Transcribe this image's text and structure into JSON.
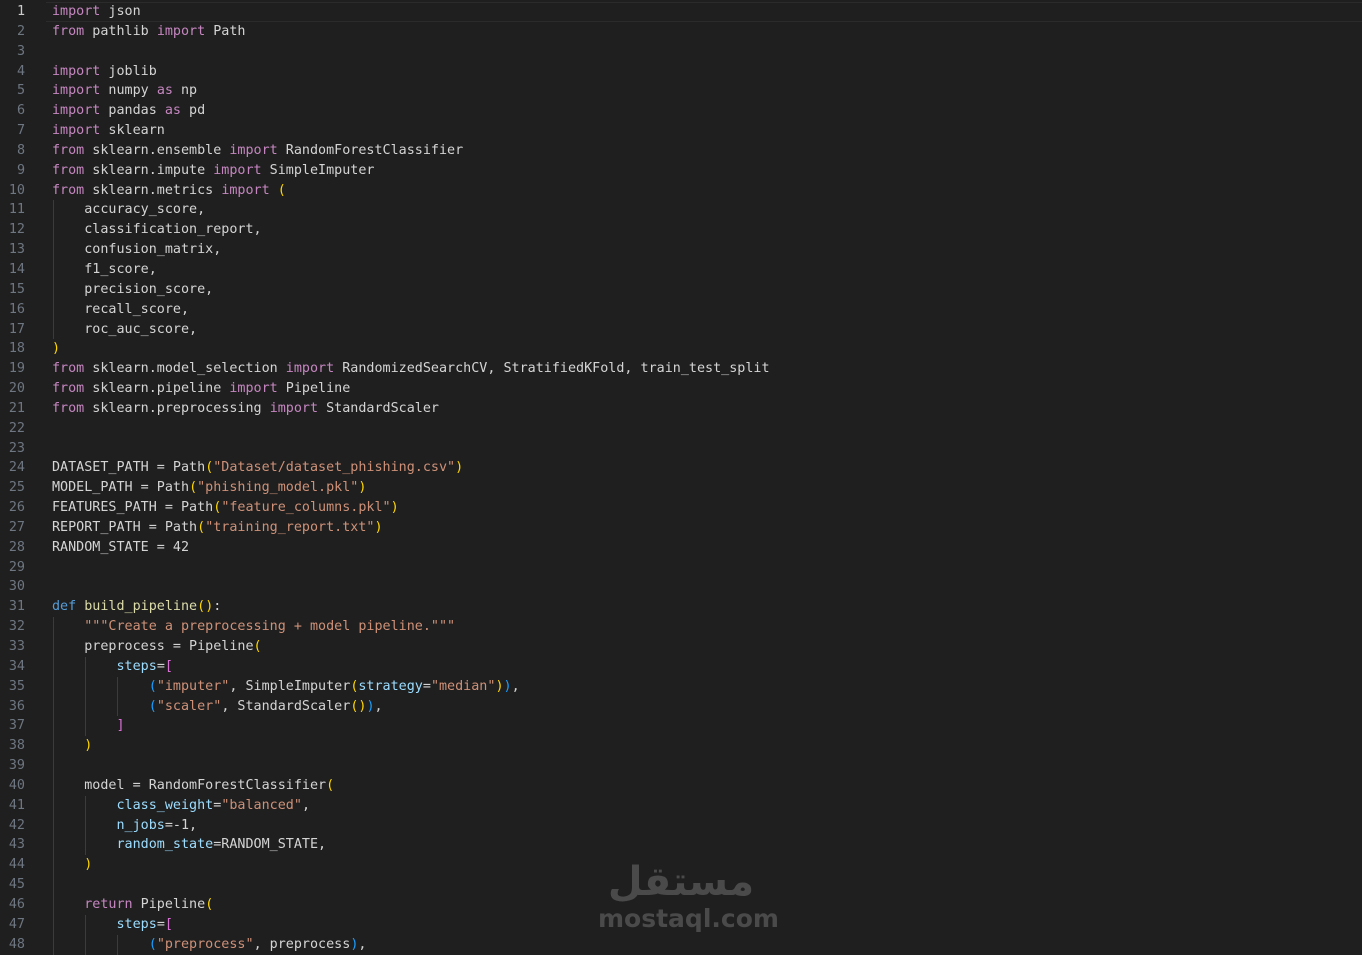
{
  "editor": {
    "current_line": 1,
    "theme_colors": {
      "background": "#1f1f1f",
      "keyword_control": "#c586c0",
      "keyword": "#569cd6",
      "function": "#dcdcaa",
      "string": "#ce9178",
      "number": "#b5cea8",
      "parameter": "#9cdcfe",
      "bracket_1": "#ffd700",
      "bracket_2": "#da70d6",
      "bracket_3": "#179fff",
      "default": "#d4d4d4"
    },
    "lines": [
      {
        "n": "1",
        "t": [
          [
            "ctrl",
            "import"
          ],
          [
            "def",
            " json"
          ]
        ]
      },
      {
        "n": "2",
        "t": [
          [
            "ctrl",
            "from"
          ],
          [
            "def",
            " pathlib "
          ],
          [
            "ctrl",
            "import"
          ],
          [
            "def",
            " Path"
          ]
        ]
      },
      {
        "n": "3",
        "t": []
      },
      {
        "n": "4",
        "t": [
          [
            "ctrl",
            "import"
          ],
          [
            "def",
            " joblib"
          ]
        ]
      },
      {
        "n": "5",
        "t": [
          [
            "ctrl",
            "import"
          ],
          [
            "def",
            " numpy "
          ],
          [
            "ctrl",
            "as"
          ],
          [
            "def",
            " np"
          ]
        ]
      },
      {
        "n": "6",
        "t": [
          [
            "ctrl",
            "import"
          ],
          [
            "def",
            " pandas "
          ],
          [
            "ctrl",
            "as"
          ],
          [
            "def",
            " pd"
          ]
        ]
      },
      {
        "n": "7",
        "t": [
          [
            "ctrl",
            "import"
          ],
          [
            "def",
            " sklearn"
          ]
        ]
      },
      {
        "n": "8",
        "t": [
          [
            "ctrl",
            "from"
          ],
          [
            "def",
            " sklearn.ensemble "
          ],
          [
            "ctrl",
            "import"
          ],
          [
            "def",
            " RandomForestClassifier"
          ]
        ]
      },
      {
        "n": "9",
        "t": [
          [
            "ctrl",
            "from"
          ],
          [
            "def",
            " sklearn.impute "
          ],
          [
            "ctrl",
            "import"
          ],
          [
            "def",
            " SimpleImputer"
          ]
        ]
      },
      {
        "n": "10",
        "t": [
          [
            "ctrl",
            "from"
          ],
          [
            "def",
            " sklearn.metrics "
          ],
          [
            "ctrl",
            "import"
          ],
          [
            "def",
            " "
          ],
          [
            "p1",
            "("
          ]
        ]
      },
      {
        "n": "11",
        "i": 1,
        "t": [
          [
            "def",
            "    accuracy_score,"
          ]
        ]
      },
      {
        "n": "12",
        "i": 1,
        "t": [
          [
            "def",
            "    classification_report,"
          ]
        ]
      },
      {
        "n": "13",
        "i": 1,
        "t": [
          [
            "def",
            "    confusion_matrix,"
          ]
        ]
      },
      {
        "n": "14",
        "i": 1,
        "t": [
          [
            "def",
            "    f1_score,"
          ]
        ]
      },
      {
        "n": "15",
        "i": 1,
        "t": [
          [
            "def",
            "    precision_score,"
          ]
        ]
      },
      {
        "n": "16",
        "i": 1,
        "t": [
          [
            "def",
            "    recall_score,"
          ]
        ]
      },
      {
        "n": "17",
        "i": 1,
        "t": [
          [
            "def",
            "    roc_auc_score,"
          ]
        ]
      },
      {
        "n": "18",
        "t": [
          [
            "p1",
            ")"
          ]
        ]
      },
      {
        "n": "19",
        "t": [
          [
            "ctrl",
            "from"
          ],
          [
            "def",
            " sklearn.model_selection "
          ],
          [
            "ctrl",
            "import"
          ],
          [
            "def",
            " RandomizedSearchCV, StratifiedKFold, train_test_split"
          ]
        ]
      },
      {
        "n": "20",
        "t": [
          [
            "ctrl",
            "from"
          ],
          [
            "def",
            " sklearn.pipeline "
          ],
          [
            "ctrl",
            "import"
          ],
          [
            "def",
            " Pipeline"
          ]
        ]
      },
      {
        "n": "21",
        "t": [
          [
            "ctrl",
            "from"
          ],
          [
            "def",
            " sklearn.preprocessing "
          ],
          [
            "ctrl",
            "import"
          ],
          [
            "def",
            " StandardScaler"
          ]
        ]
      },
      {
        "n": "22",
        "t": []
      },
      {
        "n": "23",
        "t": []
      },
      {
        "n": "24",
        "t": [
          [
            "def",
            "DATASET_PATH = Path"
          ],
          [
            "p1",
            "("
          ],
          [
            "str",
            "\"Dataset/dataset_phishing.csv\""
          ],
          [
            "p1",
            ")"
          ]
        ]
      },
      {
        "n": "25",
        "t": [
          [
            "def",
            "MODEL_PATH = Path"
          ],
          [
            "p1",
            "("
          ],
          [
            "str",
            "\"phishing_model.pkl\""
          ],
          [
            "p1",
            ")"
          ]
        ]
      },
      {
        "n": "26",
        "t": [
          [
            "def",
            "FEATURES_PATH = Path"
          ],
          [
            "p1",
            "("
          ],
          [
            "str",
            "\"feature_columns.pkl\""
          ],
          [
            "p1",
            ")"
          ]
        ]
      },
      {
        "n": "27",
        "t": [
          [
            "def",
            "REPORT_PATH = Path"
          ],
          [
            "p1",
            "("
          ],
          [
            "str",
            "\"training_report.txt\""
          ],
          [
            "p1",
            ")"
          ]
        ]
      },
      {
        "n": "28",
        "t": [
          [
            "def",
            "RANDOM_STATE = 42"
          ]
        ]
      },
      {
        "n": "29",
        "t": []
      },
      {
        "n": "30",
        "t": []
      },
      {
        "n": "31",
        "t": [
          [
            "kw",
            "def"
          ],
          [
            "def",
            " "
          ],
          [
            "fn",
            "build_pipeline"
          ],
          [
            "p1",
            "("
          ],
          [
            "p1",
            ")"
          ],
          [
            "def",
            ":"
          ]
        ]
      },
      {
        "n": "32",
        "i": 1,
        "t": [
          [
            "def",
            "    "
          ],
          [
            "str",
            "\"\"\"Create a preprocessing + model pipeline.\"\"\""
          ]
        ]
      },
      {
        "n": "33",
        "i": 1,
        "t": [
          [
            "def",
            "    preprocess = Pipeline"
          ],
          [
            "p1",
            "("
          ]
        ]
      },
      {
        "n": "34",
        "i": 2,
        "t": [
          [
            "def",
            "        "
          ],
          [
            "var",
            "steps"
          ],
          [
            "def",
            "="
          ],
          [
            "p2",
            "["
          ]
        ]
      },
      {
        "n": "35",
        "i": 3,
        "t": [
          [
            "def",
            "            "
          ],
          [
            "p3",
            "("
          ],
          [
            "str",
            "\"imputer\""
          ],
          [
            "def",
            ", SimpleImputer"
          ],
          [
            "p1",
            "("
          ],
          [
            "var",
            "strategy"
          ],
          [
            "def",
            "="
          ],
          [
            "str",
            "\"median\""
          ],
          [
            "p1",
            ")"
          ],
          [
            "p3",
            ")"
          ],
          [
            "def",
            ","
          ]
        ]
      },
      {
        "n": "36",
        "i": 3,
        "t": [
          [
            "def",
            "            "
          ],
          [
            "p3",
            "("
          ],
          [
            "str",
            "\"scaler\""
          ],
          [
            "def",
            ", StandardScaler"
          ],
          [
            "p1",
            "("
          ],
          [
            "p1",
            ")"
          ],
          [
            "p3",
            ")"
          ],
          [
            "def",
            ","
          ]
        ]
      },
      {
        "n": "37",
        "i": 2,
        "t": [
          [
            "def",
            "        "
          ],
          [
            "p2",
            "]"
          ]
        ]
      },
      {
        "n": "38",
        "i": 1,
        "t": [
          [
            "def",
            "    "
          ],
          [
            "p1",
            ")"
          ]
        ]
      },
      {
        "n": "39",
        "i": 1,
        "t": []
      },
      {
        "n": "40",
        "i": 1,
        "t": [
          [
            "def",
            "    model = RandomForestClassifier"
          ],
          [
            "p1",
            "("
          ]
        ]
      },
      {
        "n": "41",
        "i": 2,
        "t": [
          [
            "def",
            "        "
          ],
          [
            "var",
            "class_weight"
          ],
          [
            "def",
            "="
          ],
          [
            "str",
            "\"balanced\""
          ],
          [
            "def",
            ","
          ]
        ]
      },
      {
        "n": "42",
        "i": 2,
        "t": [
          [
            "def",
            "        "
          ],
          [
            "var",
            "n_jobs"
          ],
          [
            "def",
            "=-1,"
          ]
        ]
      },
      {
        "n": "43",
        "i": 2,
        "t": [
          [
            "def",
            "        "
          ],
          [
            "var",
            "random_state"
          ],
          [
            "def",
            "=RANDOM_STATE,"
          ]
        ]
      },
      {
        "n": "44",
        "i": 1,
        "t": [
          [
            "def",
            "    "
          ],
          [
            "p1",
            ")"
          ]
        ]
      },
      {
        "n": "45",
        "i": 1,
        "t": []
      },
      {
        "n": "46",
        "i": 1,
        "t": [
          [
            "def",
            "    "
          ],
          [
            "ctrl",
            "return"
          ],
          [
            "def",
            " Pipeline"
          ],
          [
            "p1",
            "("
          ]
        ]
      },
      {
        "n": "47",
        "i": 2,
        "t": [
          [
            "def",
            "        "
          ],
          [
            "var",
            "steps"
          ],
          [
            "def",
            "="
          ],
          [
            "p2",
            "["
          ]
        ]
      },
      {
        "n": "48",
        "i": 3,
        "t": [
          [
            "def",
            "            "
          ],
          [
            "p3",
            "("
          ],
          [
            "str",
            "\"preprocess\""
          ],
          [
            "def",
            ", preprocess"
          ],
          [
            "p3",
            ")"
          ],
          [
            "def",
            ","
          ]
        ]
      }
    ]
  },
  "watermark": {
    "arabic": "مستقل",
    "latin": "mostaql.com"
  }
}
